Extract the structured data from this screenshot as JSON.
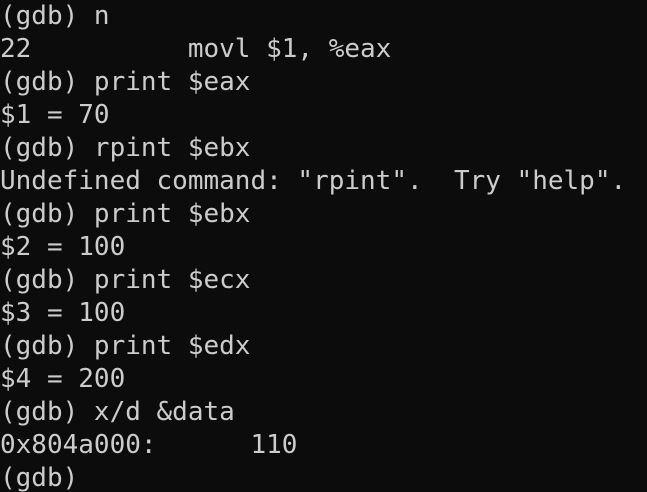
{
  "terminal": {
    "background": "#0c0c0c",
    "foreground": "#cccccc",
    "lines": [
      "(gdb) n",
      "22          movl $1, %eax",
      "(gdb) print $eax",
      "$1 = 70",
      "(gdb) rpint $ebx",
      "Undefined command: \"rpint\".  Try \"help\".",
      "(gdb) print $ebx",
      "$2 = 100",
      "(gdb) print $ecx",
      "$3 = 100",
      "(gdb) print $edx",
      "$4 = 200",
      "(gdb) x/d &data",
      "0x804a000:      110",
      "(gdb)"
    ]
  }
}
